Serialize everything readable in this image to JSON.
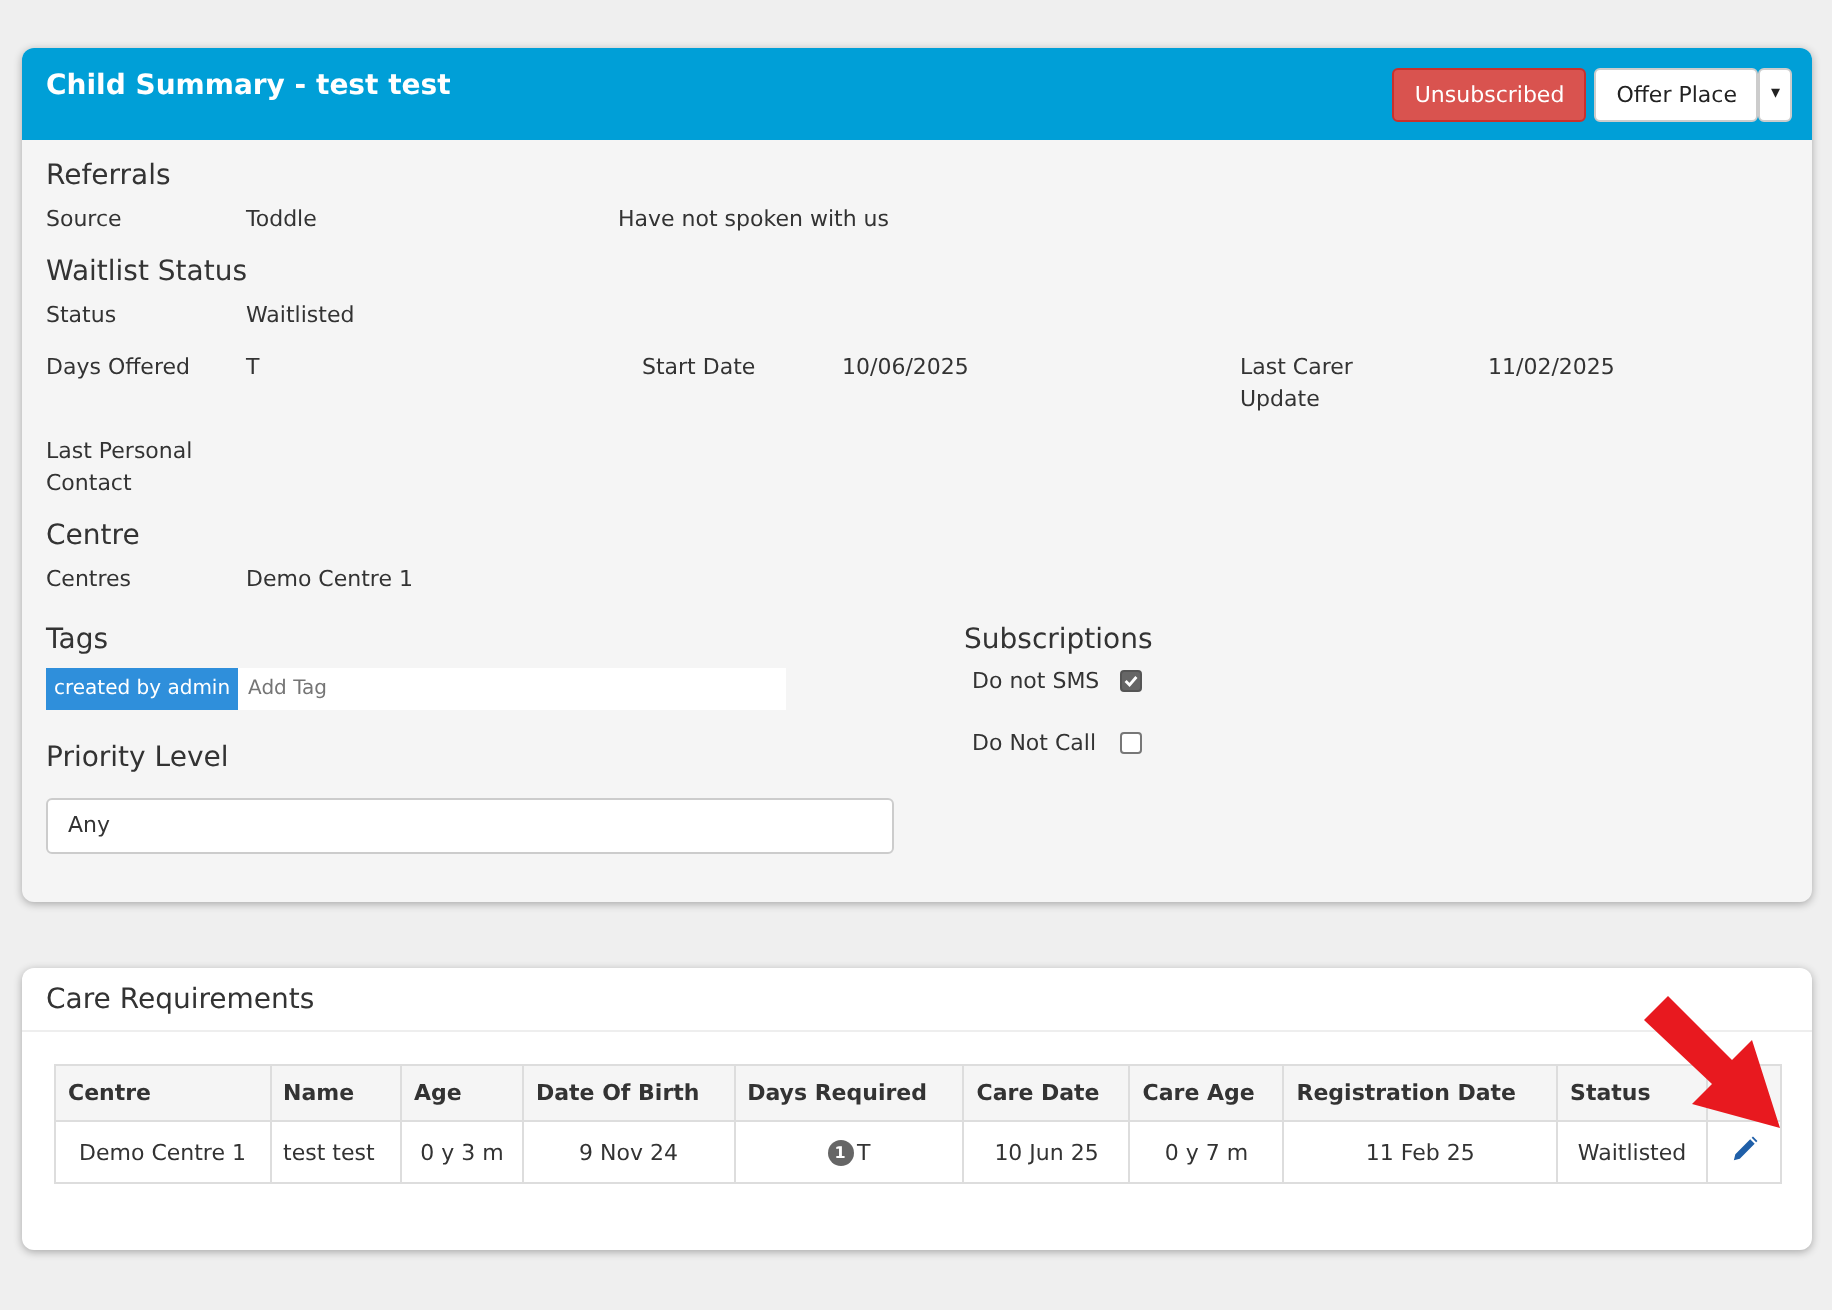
{
  "summary": {
    "title": "Child Summary - test test",
    "buttons": [
      {
        "label": "Unsubscribed",
        "kind": "danger"
      },
      {
        "label": "Offer Place",
        "kind": "default"
      }
    ],
    "dropdown_caret": "▾",
    "referrals": {
      "heading": "Referrals",
      "rows": [
        {
          "label": "Source",
          "value": "Toddle",
          "note": "Have not spoken with us"
        }
      ]
    },
    "waitlist": {
      "heading": "Waitlist Status",
      "status": {
        "label": "Status",
        "value": "Waitlisted"
      },
      "days_offered": {
        "label": "Days Offered",
        "value": "T"
      },
      "start_date": {
        "label": "Start Date",
        "value": "10/06/2025"
      },
      "last_carer_update": {
        "label": "Last Carer Update",
        "value": "11/02/2025"
      },
      "last_personal_contact": {
        "label": "Last Personal Contact"
      }
    },
    "centre": {
      "heading": "Centre",
      "label": "Centres",
      "value": "Demo Centre 1"
    },
    "tags": {
      "heading": "Tags",
      "items": [
        "created by admin"
      ],
      "placeholder": "Add Tag"
    },
    "priority": {
      "heading": "Priority Level",
      "value": "Any"
    },
    "subscriptions": {
      "heading": "Subscriptions",
      "items": [
        {
          "label": "Do not SMS",
          "checked": true
        },
        {
          "label": "Do Not Call",
          "checked": false
        }
      ]
    }
  },
  "care": {
    "title": "Care Requirements",
    "columns": [
      "Centre",
      "Name",
      "Age",
      "Date Of Birth",
      "Days Required",
      "Care Date",
      "Care Age",
      "Registration Date",
      "Status"
    ],
    "rows": [
      {
        "centre": "Demo Centre 1",
        "name": "test test",
        "age": "0 y 3 m",
        "dob": "9 Nov 24",
        "days_count": "1",
        "days": "T",
        "care_date": "10 Jun 25",
        "care_age": "0 y 7 m",
        "registration": "11 Feb 25",
        "status": "Waitlisted"
      }
    ]
  }
}
